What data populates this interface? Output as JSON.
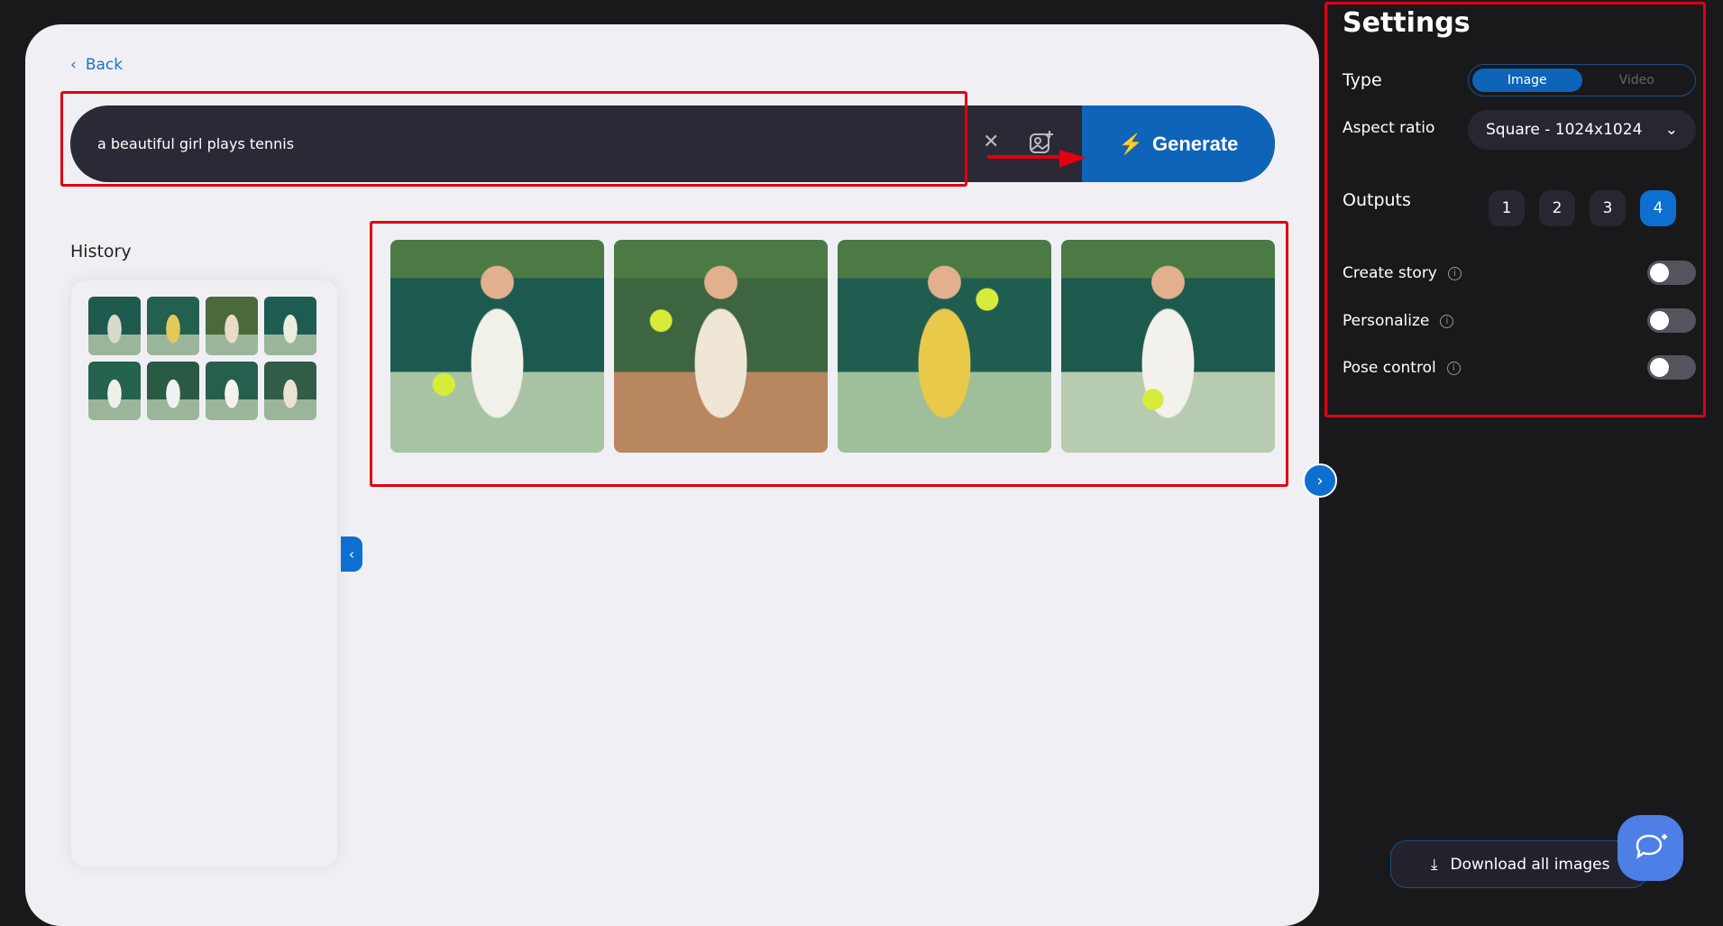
{
  "nav": {
    "back_label": "Back"
  },
  "prompt": {
    "value": "a beautiful girl plays tennis",
    "generate_label": "Generate"
  },
  "history": {
    "title": "History",
    "thumbnails": [
      "thumb-1",
      "thumb-2",
      "thumb-3",
      "thumb-4",
      "thumb-5",
      "thumb-6",
      "thumb-7",
      "thumb-8"
    ]
  },
  "results": [
    "result-1",
    "result-2",
    "result-3",
    "result-4"
  ],
  "settings": {
    "title": "Settings",
    "type": {
      "label": "Type",
      "options": [
        "Image",
        "Video"
      ],
      "selected": "Image"
    },
    "aspect_ratio": {
      "label": "Aspect ratio",
      "value": "Square - 1024x1024"
    },
    "outputs": {
      "label": "Outputs",
      "options": [
        "1",
        "2",
        "3",
        "4"
      ],
      "selected": "4"
    },
    "toggles": [
      {
        "label": "Create story",
        "on": false
      },
      {
        "label": "Personalize",
        "on": false
      },
      {
        "label": "Pose control",
        "on": false
      }
    ],
    "info_glyph": "i"
  },
  "download_label": "Download all images",
  "colors": {
    "accent": "#0d64b8",
    "annotation": "#e00010",
    "panel": "#f0f0f4",
    "dark": "#19191c"
  }
}
